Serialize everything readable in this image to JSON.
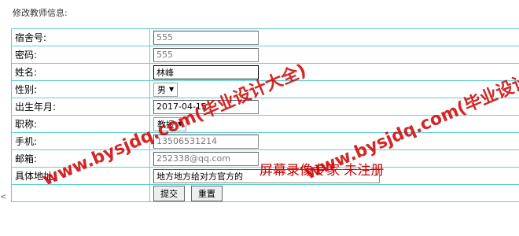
{
  "page": {
    "title": "修改教师信息:"
  },
  "form": {
    "rows": [
      {
        "label": "宿舍号:",
        "value": "555",
        "kind": "input",
        "readonly": true
      },
      {
        "label": "密码:",
        "value": "555",
        "kind": "input",
        "readonly": true
      },
      {
        "label": "姓名:",
        "value": "林峰",
        "kind": "input",
        "readonly": false
      },
      {
        "label": "性别:",
        "value": "男",
        "kind": "select"
      },
      {
        "label": "出生年月:",
        "value": "2017-04-15",
        "kind": "input",
        "readonly": false
      },
      {
        "label": "职称:",
        "value": "教授",
        "kind": "select"
      },
      {
        "label": "手机:",
        "value": "13506531214",
        "kind": "input",
        "readonly": true
      },
      {
        "label": "邮箱:",
        "value": "252338@qq.com",
        "kind": "input",
        "readonly": true
      },
      {
        "label": "具体地址:",
        "value": "地方地方给对方官方的",
        "kind": "input",
        "readonly": false
      }
    ],
    "submit_label": "提交",
    "reset_label": "重置"
  },
  "watermark": {
    "lines": [
      "www.bysjdq.com(毕业设计大全)",
      "www.bysjdq.com(毕业设计大全)"
    ],
    "recorder": "屏幕录像专家 未注册",
    "color": "#cc0000"
  },
  "left_handle": "<"
}
